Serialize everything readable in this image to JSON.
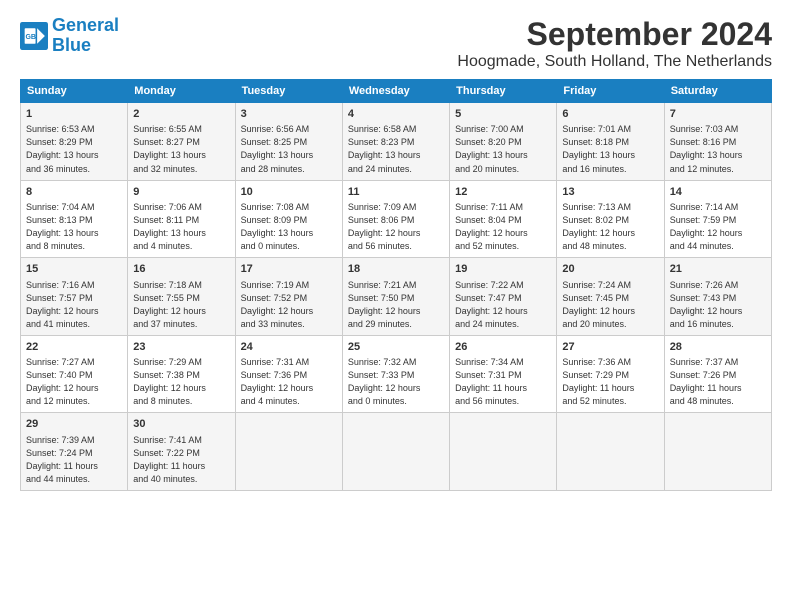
{
  "logo": {
    "line1": "General",
    "line2": "Blue"
  },
  "title": "September 2024",
  "subtitle": "Hoogmade, South Holland, The Netherlands",
  "days_of_week": [
    "Sunday",
    "Monday",
    "Tuesday",
    "Wednesday",
    "Thursday",
    "Friday",
    "Saturday"
  ],
  "weeks": [
    [
      {
        "day": 1,
        "lines": [
          "Sunrise: 6:53 AM",
          "Sunset: 8:29 PM",
          "Daylight: 13 hours",
          "and 36 minutes."
        ]
      },
      {
        "day": 2,
        "lines": [
          "Sunrise: 6:55 AM",
          "Sunset: 8:27 PM",
          "Daylight: 13 hours",
          "and 32 minutes."
        ]
      },
      {
        "day": 3,
        "lines": [
          "Sunrise: 6:56 AM",
          "Sunset: 8:25 PM",
          "Daylight: 13 hours",
          "and 28 minutes."
        ]
      },
      {
        "day": 4,
        "lines": [
          "Sunrise: 6:58 AM",
          "Sunset: 8:23 PM",
          "Daylight: 13 hours",
          "and 24 minutes."
        ]
      },
      {
        "day": 5,
        "lines": [
          "Sunrise: 7:00 AM",
          "Sunset: 8:20 PM",
          "Daylight: 13 hours",
          "and 20 minutes."
        ]
      },
      {
        "day": 6,
        "lines": [
          "Sunrise: 7:01 AM",
          "Sunset: 8:18 PM",
          "Daylight: 13 hours",
          "and 16 minutes."
        ]
      },
      {
        "day": 7,
        "lines": [
          "Sunrise: 7:03 AM",
          "Sunset: 8:16 PM",
          "Daylight: 13 hours",
          "and 12 minutes."
        ]
      }
    ],
    [
      {
        "day": 8,
        "lines": [
          "Sunrise: 7:04 AM",
          "Sunset: 8:13 PM",
          "Daylight: 13 hours",
          "and 8 minutes."
        ]
      },
      {
        "day": 9,
        "lines": [
          "Sunrise: 7:06 AM",
          "Sunset: 8:11 PM",
          "Daylight: 13 hours",
          "and 4 minutes."
        ]
      },
      {
        "day": 10,
        "lines": [
          "Sunrise: 7:08 AM",
          "Sunset: 8:09 PM",
          "Daylight: 13 hours",
          "and 0 minutes."
        ]
      },
      {
        "day": 11,
        "lines": [
          "Sunrise: 7:09 AM",
          "Sunset: 8:06 PM",
          "Daylight: 12 hours",
          "and 56 minutes."
        ]
      },
      {
        "day": 12,
        "lines": [
          "Sunrise: 7:11 AM",
          "Sunset: 8:04 PM",
          "Daylight: 12 hours",
          "and 52 minutes."
        ]
      },
      {
        "day": 13,
        "lines": [
          "Sunrise: 7:13 AM",
          "Sunset: 8:02 PM",
          "Daylight: 12 hours",
          "and 48 minutes."
        ]
      },
      {
        "day": 14,
        "lines": [
          "Sunrise: 7:14 AM",
          "Sunset: 7:59 PM",
          "Daylight: 12 hours",
          "and 44 minutes."
        ]
      }
    ],
    [
      {
        "day": 15,
        "lines": [
          "Sunrise: 7:16 AM",
          "Sunset: 7:57 PM",
          "Daylight: 12 hours",
          "and 41 minutes."
        ]
      },
      {
        "day": 16,
        "lines": [
          "Sunrise: 7:18 AM",
          "Sunset: 7:55 PM",
          "Daylight: 12 hours",
          "and 37 minutes."
        ]
      },
      {
        "day": 17,
        "lines": [
          "Sunrise: 7:19 AM",
          "Sunset: 7:52 PM",
          "Daylight: 12 hours",
          "and 33 minutes."
        ]
      },
      {
        "day": 18,
        "lines": [
          "Sunrise: 7:21 AM",
          "Sunset: 7:50 PM",
          "Daylight: 12 hours",
          "and 29 minutes."
        ]
      },
      {
        "day": 19,
        "lines": [
          "Sunrise: 7:22 AM",
          "Sunset: 7:47 PM",
          "Daylight: 12 hours",
          "and 24 minutes."
        ]
      },
      {
        "day": 20,
        "lines": [
          "Sunrise: 7:24 AM",
          "Sunset: 7:45 PM",
          "Daylight: 12 hours",
          "and 20 minutes."
        ]
      },
      {
        "day": 21,
        "lines": [
          "Sunrise: 7:26 AM",
          "Sunset: 7:43 PM",
          "Daylight: 12 hours",
          "and 16 minutes."
        ]
      }
    ],
    [
      {
        "day": 22,
        "lines": [
          "Sunrise: 7:27 AM",
          "Sunset: 7:40 PM",
          "Daylight: 12 hours",
          "and 12 minutes."
        ]
      },
      {
        "day": 23,
        "lines": [
          "Sunrise: 7:29 AM",
          "Sunset: 7:38 PM",
          "Daylight: 12 hours",
          "and 8 minutes."
        ]
      },
      {
        "day": 24,
        "lines": [
          "Sunrise: 7:31 AM",
          "Sunset: 7:36 PM",
          "Daylight: 12 hours",
          "and 4 minutes."
        ]
      },
      {
        "day": 25,
        "lines": [
          "Sunrise: 7:32 AM",
          "Sunset: 7:33 PM",
          "Daylight: 12 hours",
          "and 0 minutes."
        ]
      },
      {
        "day": 26,
        "lines": [
          "Sunrise: 7:34 AM",
          "Sunset: 7:31 PM",
          "Daylight: 11 hours",
          "and 56 minutes."
        ]
      },
      {
        "day": 27,
        "lines": [
          "Sunrise: 7:36 AM",
          "Sunset: 7:29 PM",
          "Daylight: 11 hours",
          "and 52 minutes."
        ]
      },
      {
        "day": 28,
        "lines": [
          "Sunrise: 7:37 AM",
          "Sunset: 7:26 PM",
          "Daylight: 11 hours",
          "and 48 minutes."
        ]
      }
    ],
    [
      {
        "day": 29,
        "lines": [
          "Sunrise: 7:39 AM",
          "Sunset: 7:24 PM",
          "Daylight: 11 hours",
          "and 44 minutes."
        ]
      },
      {
        "day": 30,
        "lines": [
          "Sunrise: 7:41 AM",
          "Sunset: 7:22 PM",
          "Daylight: 11 hours",
          "and 40 minutes."
        ]
      },
      null,
      null,
      null,
      null,
      null
    ]
  ],
  "colors": {
    "header_bg": "#1a7fc1",
    "odd_row": "#f5f5f5",
    "even_row": "#ffffff"
  }
}
